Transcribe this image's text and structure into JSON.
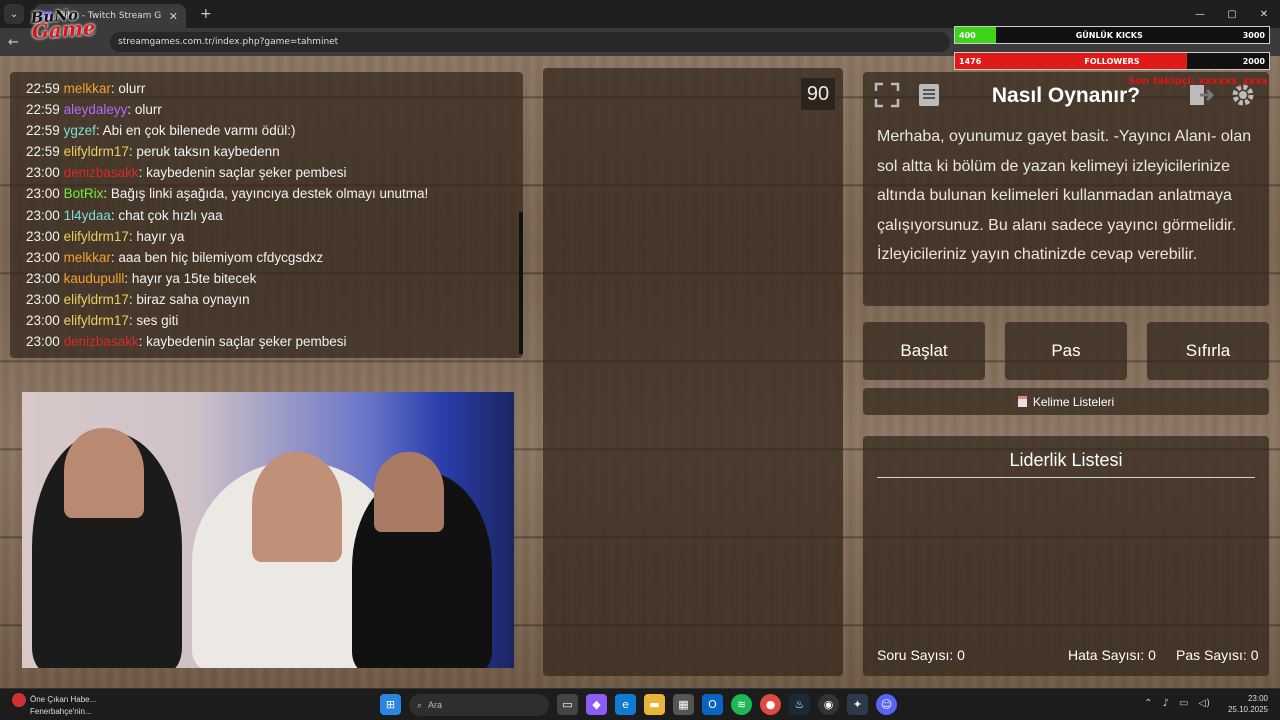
{
  "browser": {
    "tab_title": "Tabu - Twitch Stream G",
    "url": "streamgames.com.tr/index.php?game=tahminet",
    "new_tab": "+",
    "window_controls": [
      "—",
      "▢",
      "✕"
    ]
  },
  "logo": {
    "line1": "BuNo",
    "line2": "Game"
  },
  "overlay": {
    "kicks": {
      "left": "400",
      "label": "GÜNLÜK KICKS",
      "right": "3000",
      "fill_fraction": 0.13,
      "fill_color": "#3fd21a"
    },
    "followers": {
      "left": "1476",
      "label": "FOLLOWERS",
      "right": "2000",
      "fill_fraction": 0.74,
      "fill_color": "#e01919"
    },
    "note": "Son takipçi: xxxxxx_xxxx"
  },
  "chat": {
    "messages": [
      {
        "time": "22:59",
        "user": "melkkar",
        "color": "#f0a030",
        "text": ": olurr"
      },
      {
        "time": "22:59",
        "user": "aleydaleyy",
        "color": "#b368ff",
        "text": ": olurr"
      },
      {
        "time": "22:59",
        "user": "ygzef",
        "color": "#7ae0d0",
        "text": ": Abi en çok bilenede varmı ödül:)"
      },
      {
        "time": "22:59",
        "user": "elifyldrm17",
        "color": "#e8d060",
        "text": ": peruk taksın kaybedenn"
      },
      {
        "time": "23:00",
        "user": "denizbasakk",
        "color": "#d62a2a",
        "text": ": kaybedenin saçlar şeker pembesi"
      },
      {
        "time": "23:00",
        "user": "BotRix",
        "color": "#6cf03c",
        "text": ": Bağış linki aşağıda, yayıncıya destek olmayı unutma!"
      },
      {
        "time": "23:00",
        "user": "1l4ydaa",
        "color": "#7ae0d0",
        "text": ": chat çok hızlı yaa"
      },
      {
        "time": "23:00",
        "user": "elifyldrm17",
        "color": "#e8d060",
        "text": ": hayır ya"
      },
      {
        "time": "23:00",
        "user": "melkkar",
        "color": "#f0a030",
        "text": ": aaa ben hiç bilemiyom cfdycgsdxz"
      },
      {
        "time": "23:00",
        "user": "kaudupulll",
        "color": "#f0a030",
        "text": ": hayır ya 15te bitecek"
      },
      {
        "time": "23:00",
        "user": "elifyldrm17",
        "color": "#e8d060",
        "text": ": biraz saha oynayın"
      },
      {
        "time": "23:00",
        "user": "elifyldrm17",
        "color": "#e8d060",
        "text": ": ses giti"
      },
      {
        "time": "23:00",
        "user": "denizbasakk",
        "color": "#d62a2a",
        "text": ": kaybedenin saçlar şeker pembesi"
      }
    ]
  },
  "timer": "90",
  "howto": {
    "title": "Nasıl Oynanır?",
    "text": "Merhaba, oyunumuz gayet basit. -Yayıncı Alanı- olan sol altta ki bölüm de yazan kelimeyi izleyicilerinize altında bulunan kelimeleri kullanmadan anlatmaya çalışıyorsunuz. Bu alanı sadece yayıncı görmelidir. İzleyicileriniz yayın chatinizde cevap verebilir."
  },
  "buttons": {
    "start": "Başlat",
    "pass": "Pas",
    "reset": "Sıfırla",
    "word_lists": "Kelime Listeleri"
  },
  "leaderboard": {
    "title": "Liderlik Listesi",
    "question_count_label": "Soru Sayısı:",
    "question_count": "0",
    "error_count_label": "Hata Sayısı:",
    "error_count": "0",
    "pass_count_label": "Pas Sayısı:",
    "pass_count": "0"
  },
  "taskbar": {
    "news_title": "Öne Çıkan Habe...",
    "news_sub": "Fenerbahçe'nin...",
    "news_badge": "4",
    "search_placeholder": "Ara",
    "time": "23:00",
    "date": "25.10.2025"
  }
}
